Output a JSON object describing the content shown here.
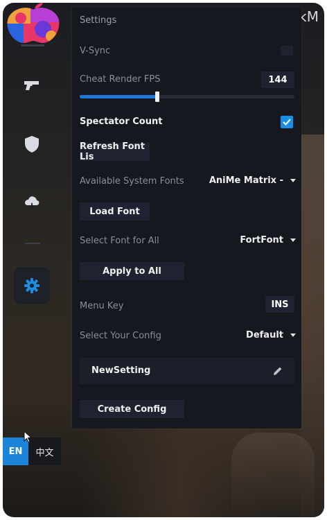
{
  "background": {
    "corner_text": "arkM"
  },
  "sidebar": {
    "logo": "apple-logo",
    "items": [
      {
        "icon": "gun-icon"
      },
      {
        "icon": "shield-icon"
      },
      {
        "icon": "cloud-icon"
      },
      {
        "icon": "gear-icon",
        "active": true
      }
    ]
  },
  "panel": {
    "title": "Settings",
    "vsync": {
      "label": "V-Sync",
      "checked": false
    },
    "fps": {
      "label": "Cheat Render FPS",
      "value": "144",
      "slider_fraction": 0.36
    },
    "spectator": {
      "label": "Spectator Count",
      "checked": true
    },
    "refresh_font_button": "Refresh Font Lis",
    "system_fonts": {
      "label": "Available System Fonts",
      "selected": "AniMe Matrix -"
    },
    "load_font_button": "Load Font",
    "font_for_all": {
      "label": "Select Font for All",
      "selected": "FortFont"
    },
    "apply_button": "Apply to All",
    "menu_key": {
      "label": "Menu Key",
      "value": "INS"
    },
    "config": {
      "label": "Select Your Config",
      "selected": "Default"
    },
    "config_item": {
      "name": "NewSetting"
    },
    "create_button": "Create Config"
  },
  "language": {
    "en": "EN",
    "zh": "中文"
  },
  "colors": {
    "accent": "#1d76d8",
    "panel": "#161820",
    "control": "#1f2230"
  }
}
